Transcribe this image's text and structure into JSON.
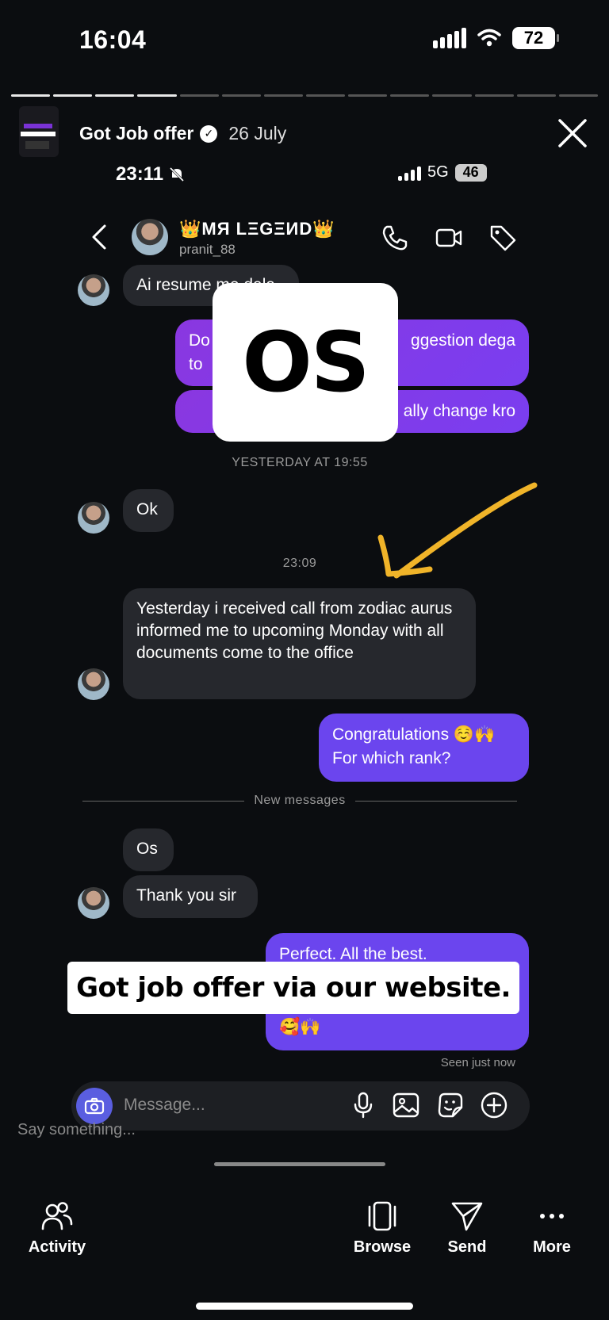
{
  "status": {
    "time": "16:04",
    "battery": "72"
  },
  "story": {
    "title": "Got Job offer",
    "date": "26 July"
  },
  "inner_status": {
    "time": "23:11",
    "network": "5G",
    "battery": "46"
  },
  "chat": {
    "name": "👑MЯ LΞGΞИD👑",
    "username": "pranit_88"
  },
  "messages": {
    "m1": "Ai resume me dala",
    "m2a": "Do",
    "m2b": "ggestion dega",
    "m2c": "to",
    "m3": "ally change kro",
    "ts1": "YESTERDAY AT 19:55",
    "m4": "Ok",
    "ts2": "23:09",
    "m5": "Yesterday i received call from zodiac aurus informed me to upcoming Monday with all documents come to the office",
    "m6a": "Congratulations ☺️🙌",
    "m6b": "For which rank?",
    "new_messages": "New messages",
    "m7": "Os",
    "m8": "Thank you sir",
    "m9a": "Perfect. All the best.",
    "m9b": "🥰🙌",
    "seen": "Seen just now"
  },
  "overlay_sticker": "OS",
  "caption": "Got job offer via our website.",
  "composer": {
    "placeholder": "Message..."
  },
  "story_reply": {
    "placeholder": "Say something..."
  },
  "bottom_bar": {
    "activity": "Activity",
    "browse": "Browse",
    "send": "Send",
    "more": "More"
  },
  "colors": {
    "background": "#0b0d10",
    "incoming_bubble": "#26282d",
    "outgoing_bubble": "#8a37e0",
    "outgoing_bubble_alt": "#6b45ee",
    "camera_button": "#5a5ee0",
    "arrow": "#f0b429"
  },
  "icons": [
    "signal-icon",
    "wifi-icon",
    "close-icon",
    "mute-bell-icon",
    "back-chevron-icon",
    "phone-icon",
    "video-icon",
    "tag-icon",
    "camera-icon",
    "mic-icon",
    "gallery-icon",
    "sticker-icon",
    "plus-icon",
    "activity-icon",
    "browse-icon",
    "send-icon",
    "more-icon"
  ]
}
